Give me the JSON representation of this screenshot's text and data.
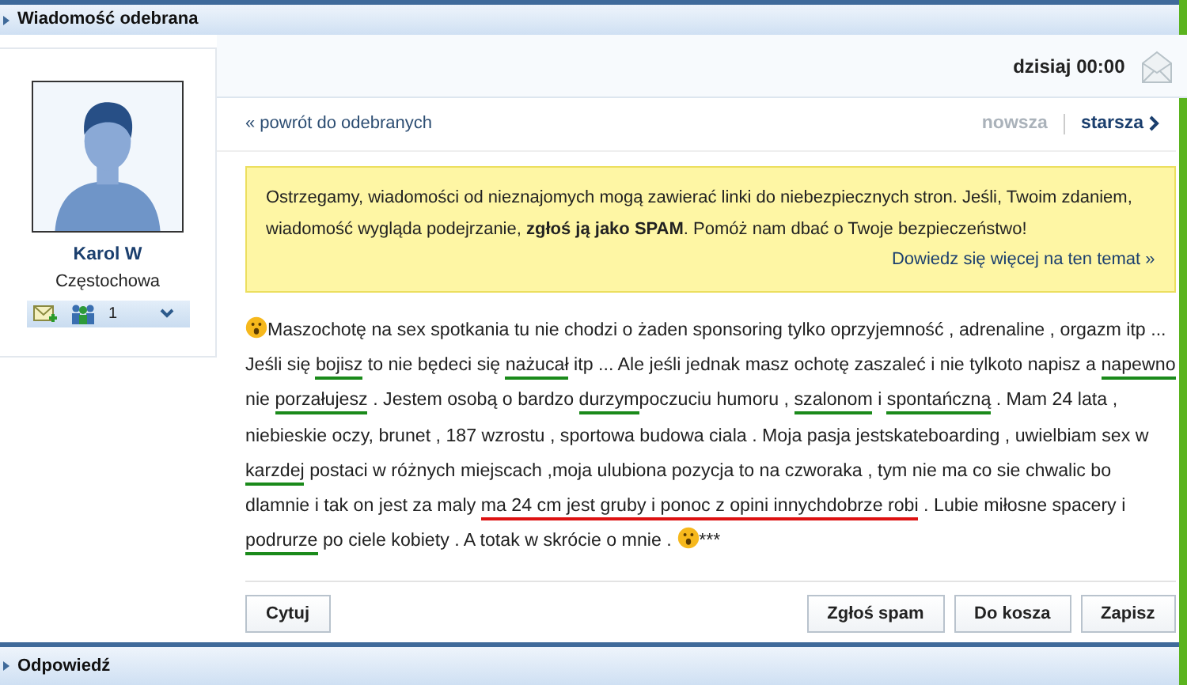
{
  "header": {
    "title": "Wiadomość odebrana"
  },
  "sender": {
    "name": "Karol W",
    "city": "Częstochowa",
    "friends_count": "1"
  },
  "date": "dzisiaj 00:00",
  "nav": {
    "back": "« powrót do odebranych",
    "pager": [
      {
        "label": "nowsza",
        "disabled": true
      },
      {
        "label": "starsza",
        "disabled": false
      }
    ]
  },
  "warning": {
    "text": "Ostrzegamy, wiadomości od nieznajomych mogą zawierać linki do niebezpiecznych stron. Jeśli, Twoim zdaniem, wiadomość wygląda podejrzanie, **zgłoś ją jako SPAM**. Pomóż nam dbać o Twoje bezpieczeństwo!",
    "link": "Dowiedz się więcej na ten temat »"
  },
  "message": [
    [
      {
        "kind": "emoticon"
      },
      {
        "kind": "text",
        "text": "Maszochotę na sex spotkania tu nie chodzi o żaden sponsoring tylko oprzyjemność , adrenaline , orgazm itp ..."
      }
    ],
    [
      {
        "kind": "text",
        "text": "Jeśli się "
      },
      {
        "kind": "marked",
        "text": "bojisz",
        "color": "#1a8a1a"
      },
      {
        "kind": "text",
        "text": " to nie będeci się "
      },
      {
        "kind": "marked",
        "text": "nażucał",
        "color": "#1a8a1a"
      },
      {
        "kind": "text",
        "text": " itp ... Ale jeśli jednak masz ochotę zaszaleć i nie tylkoto napisz a "
      },
      {
        "kind": "marked",
        "text": "napewno",
        "color": "#1a8a1a"
      }
    ],
    [
      {
        "kind": "text",
        "text": "nie "
      },
      {
        "kind": "marked",
        "text": "porzałujesz",
        "color": "#1a8a1a"
      },
      {
        "kind": "text",
        "text": " . Jestem osobą o bardzo "
      },
      {
        "kind": "marked",
        "text": "durzym",
        "color": "#1a8a1a"
      },
      {
        "kind": "text",
        "text": "poczuciu humoru , "
      },
      {
        "kind": "marked",
        "text": "szalonom",
        "color": "#1a8a1a"
      },
      {
        "kind": "text",
        "text": " i "
      },
      {
        "kind": "marked",
        "text": "spontańczną",
        "color": "#1a8a1a"
      },
      {
        "kind": "text",
        "text": " . Mam 24 lata ,"
      }
    ],
    [
      {
        "kind": "text",
        "text": "niebieskie oczy, brunet , 187 wzrostu , sportowa budowa ciala . Moja pasja jestskateboarding , uwielbiam sex w"
      }
    ],
    [
      {
        "kind": "marked",
        "text": "karzdej",
        "color": "#1a8a1a"
      },
      {
        "kind": "text",
        "text": " postaci w różnych miejscach ,moja ulubiona pozycja to na czworaka , tym nie ma co sie chwalic bo"
      }
    ],
    [
      {
        "kind": "text",
        "text": "dlamnie i tak on jest za maly "
      },
      {
        "kind": "marked",
        "text": "ma 24 cm jest gruby i ponoc z opini innychdobrze robi",
        "color": "#dd1111"
      },
      {
        "kind": "text",
        "text": " . Lubie miłosne spacery i"
      }
    ],
    [
      {
        "kind": "marked",
        "text": "podrurze",
        "color": "#1a8a1a"
      },
      {
        "kind": "text",
        "text": " po ciele kobiety . A totak w skrócie o mnie . "
      },
      {
        "kind": "emoticon"
      },
      {
        "kind": "text",
        "text": "***"
      }
    ]
  ],
  "actions": {
    "left": [
      "Cytuj"
    ],
    "right": [
      "Zgłoś spam",
      "Do kosza",
      "Zapisz"
    ]
  },
  "reply_bar": {
    "title": "Odpowiedź"
  }
}
